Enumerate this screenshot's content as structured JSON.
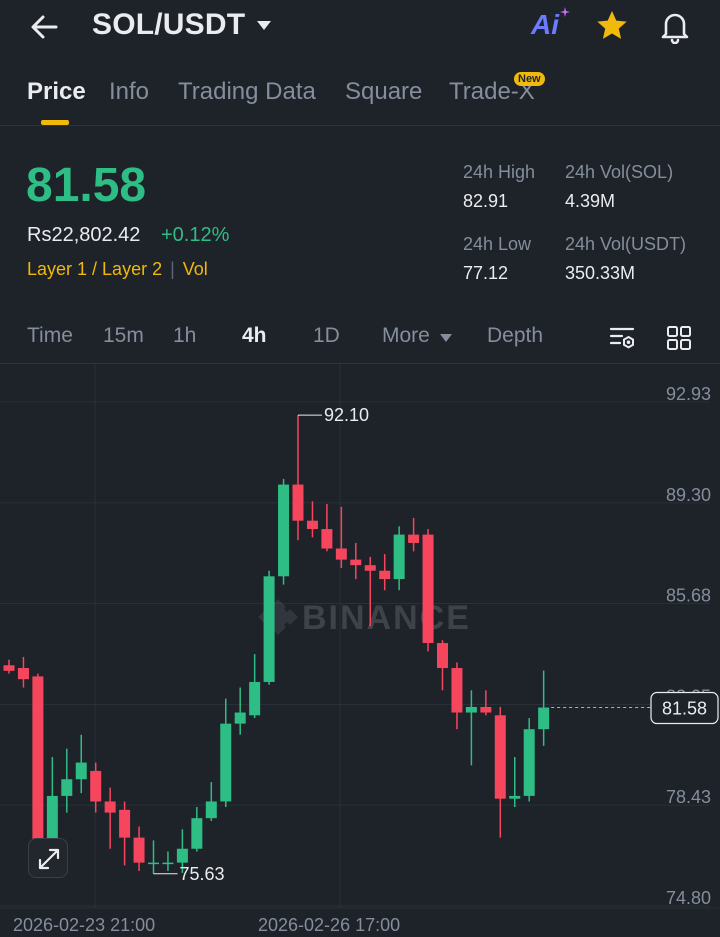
{
  "header": {
    "pair": "SOL/USDT",
    "ai_label": "Ai",
    "icons": [
      "back-arrow-icon",
      "caret-down-icon",
      "ai-icon",
      "star-icon",
      "bell-icon"
    ]
  },
  "tabs": [
    {
      "label": "Price",
      "active": true
    },
    {
      "label": "Info"
    },
    {
      "label": "Trading Data"
    },
    {
      "label": "Square"
    },
    {
      "label": "Trade-X",
      "badge": "New"
    }
  ],
  "summary": {
    "last_price": "81.58",
    "fiat_price": "Rs22,802.42",
    "change_pct": "+0.12%",
    "tags": [
      "Layer 1 / Layer 2",
      "Vol"
    ],
    "stats": {
      "high_label": "24h High",
      "high_value": "82.91",
      "vol_base_label": "24h Vol(SOL)",
      "vol_base_value": "4.39M",
      "low_label": "24h Low",
      "low_value": "77.12",
      "vol_quote_label": "24h Vol(USDT)",
      "vol_quote_value": "350.33M"
    }
  },
  "intervals": {
    "items": [
      "Time",
      "15m",
      "1h",
      "4h",
      "1D",
      "More",
      "Depth"
    ],
    "active": "4h"
  },
  "colors": {
    "up": "#2ebd85",
    "down": "#f6465d",
    "accent": "#f0b90b",
    "background": "#1e2229"
  },
  "chart_data": {
    "type": "candlestick",
    "watermark": "BINANCE",
    "y_ticks": [
      "92.93",
      "89.30",
      "85.68",
      "82.05",
      "78.43",
      "74.80"
    ],
    "ylim": [
      74.8,
      92.93
    ],
    "x_labels": [
      "2026-02-23 21:00",
      "2026-02-26 17:00"
    ],
    "max_label": "92.10",
    "min_label": "75.63",
    "last_price_label": "81.58",
    "last_price": 81.58,
    "candles": [
      {
        "o": 83.1,
        "h": 83.3,
        "l": 82.8,
        "c": 82.9
      },
      {
        "o": 83.0,
        "h": 83.4,
        "l": 82.3,
        "c": 82.6
      },
      {
        "o": 82.7,
        "h": 82.8,
        "l": 76.2,
        "c": 76.6
      },
      {
        "o": 76.6,
        "h": 79.8,
        "l": 76.3,
        "c": 78.4
      },
      {
        "o": 78.4,
        "h": 80.1,
        "l": 77.8,
        "c": 79.0
      },
      {
        "o": 79.0,
        "h": 80.6,
        "l": 78.5,
        "c": 79.6
      },
      {
        "o": 79.3,
        "h": 79.6,
        "l": 77.8,
        "c": 78.2
      },
      {
        "o": 78.2,
        "h": 78.7,
        "l": 76.5,
        "c": 77.8
      },
      {
        "o": 77.9,
        "h": 78.2,
        "l": 75.9,
        "c": 76.9
      },
      {
        "o": 76.9,
        "h": 77.3,
        "l": 75.7,
        "c": 76.0
      },
      {
        "o": 76.0,
        "h": 76.8,
        "l": 75.6,
        "c": 76.0
      },
      {
        "o": 76.0,
        "h": 76.4,
        "l": 75.7,
        "c": 76.0
      },
      {
        "o": 76.0,
        "h": 77.2,
        "l": 75.63,
        "c": 76.5
      },
      {
        "o": 76.5,
        "h": 78.0,
        "l": 76.4,
        "c": 77.6
      },
      {
        "o": 77.6,
        "h": 78.9,
        "l": 77.5,
        "c": 78.2
      },
      {
        "o": 78.2,
        "h": 81.9,
        "l": 78.0,
        "c": 81.0
      },
      {
        "o": 81.0,
        "h": 82.3,
        "l": 80.6,
        "c": 81.4
      },
      {
        "o": 81.3,
        "h": 83.5,
        "l": 81.2,
        "c": 82.5
      },
      {
        "o": 82.5,
        "h": 86.5,
        "l": 82.4,
        "c": 86.3
      },
      {
        "o": 86.3,
        "h": 89.8,
        "l": 86.0,
        "c": 89.6
      },
      {
        "o": 89.6,
        "h": 92.1,
        "l": 87.6,
        "c": 88.3
      },
      {
        "o": 88.3,
        "h": 89.0,
        "l": 87.7,
        "c": 88.0
      },
      {
        "o": 88.0,
        "h": 88.9,
        "l": 87.2,
        "c": 87.3
      },
      {
        "o": 87.3,
        "h": 88.8,
        "l": 86.6,
        "c": 86.9
      },
      {
        "o": 86.9,
        "h": 87.5,
        "l": 86.2,
        "c": 86.7
      },
      {
        "o": 86.7,
        "h": 87.0,
        "l": 84.5,
        "c": 86.5
      },
      {
        "o": 86.5,
        "h": 87.1,
        "l": 85.8,
        "c": 86.2
      },
      {
        "o": 86.2,
        "h": 88.1,
        "l": 85.8,
        "c": 87.8
      },
      {
        "o": 87.8,
        "h": 88.4,
        "l": 87.2,
        "c": 87.5
      },
      {
        "o": 87.8,
        "h": 88.0,
        "l": 83.6,
        "c": 83.9
      },
      {
        "o": 83.9,
        "h": 84.0,
        "l": 82.2,
        "c": 83.0
      },
      {
        "o": 83.0,
        "h": 83.2,
        "l": 80.8,
        "c": 81.4
      },
      {
        "o": 81.4,
        "h": 82.2,
        "l": 79.5,
        "c": 81.6
      },
      {
        "o": 81.6,
        "h": 82.2,
        "l": 81.3,
        "c": 81.4
      },
      {
        "o": 81.3,
        "h": 81.6,
        "l": 76.9,
        "c": 78.3
      },
      {
        "o": 78.3,
        "h": 79.8,
        "l": 78.0,
        "c": 78.4
      },
      {
        "o": 78.4,
        "h": 81.2,
        "l": 78.2,
        "c": 80.8
      },
      {
        "o": 80.8,
        "h": 82.91,
        "l": 80.2,
        "c": 81.58
      }
    ]
  }
}
